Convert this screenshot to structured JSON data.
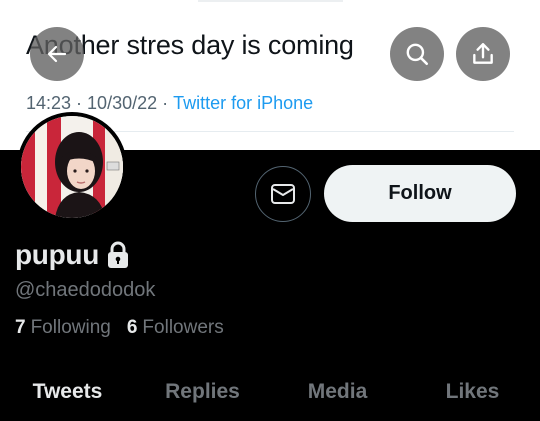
{
  "banner": {
    "tweet_text": "Another stres day is coming",
    "time": "14:23",
    "date": "10/30/22",
    "separator": "·",
    "source": "Twitter for iPhone"
  },
  "topbar": {
    "back_icon": "arrow-left-icon",
    "search_icon": "search-icon",
    "share_icon": "share-upload-icon"
  },
  "profile": {
    "display_name": "pupuu",
    "handle": "@chaedododok",
    "locked_icon": "lock-icon",
    "following_count": "7",
    "following_label": "Following",
    "followers_count": "6",
    "followers_label": "Followers"
  },
  "actions": {
    "message_icon": "envelope-icon",
    "follow_label": "Follow"
  },
  "tabs": [
    {
      "label": "Tweets",
      "active": true
    },
    {
      "label": "Replies",
      "active": false
    },
    {
      "label": "Media",
      "active": false
    },
    {
      "label": "Likes",
      "active": false
    }
  ],
  "colors": {
    "background": "#000000",
    "primary_text": "#e7e9ea",
    "secondary_text": "#71767b",
    "link_blue": "#1d9bf0",
    "follow_button_bg": "#eff3f4"
  }
}
